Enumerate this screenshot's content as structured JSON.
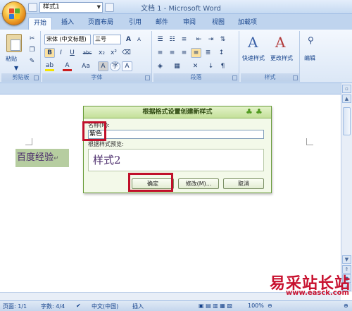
{
  "titlebar": {
    "window_title": "文档 1 - Microsoft Word",
    "style_combo_value": "样式1"
  },
  "tabs": [
    "开始",
    "插入",
    "页面布局",
    "引用",
    "邮件",
    "审阅",
    "视图",
    "加载项"
  ],
  "ribbon": {
    "clipboard": {
      "paste_label": "粘贴",
      "group_label": "剪贴板"
    },
    "font": {
      "font_name": "宋体 (中文标题)",
      "font_size": "三号",
      "bold": "B",
      "italic": "I",
      "underline": "U",
      "strike": "abc",
      "subscript": "x₂",
      "superscript": "x²",
      "change_case": "Aa",
      "char_shading": "A",
      "enclose": "字",
      "grow": "A",
      "shrink": "A",
      "group_label": "字体"
    },
    "paragraph": {
      "group_label": "段落"
    },
    "styles": {
      "quick_styles_label": "快速样式",
      "change_styles_label": "更改样式",
      "group_label": "样式"
    },
    "editing": {
      "label": "编辑"
    }
  },
  "document": {
    "heading_text": "百度经验",
    "para_mark": "↵"
  },
  "dialog": {
    "title": "根据格式设置创建新样式",
    "name_label": "名称(N):",
    "name_value": "紫色",
    "preview_label": "根据样式预览:",
    "preview_text": "样式2",
    "ok_label": "确定",
    "modify_label": "修改(M)...",
    "cancel_label": "取消"
  },
  "statusbar": {
    "page": "页面: 1/1",
    "words": "字数: 4/4",
    "language": "中文(中国)",
    "insert_mode": "插入",
    "zoom": "100%"
  },
  "watermark": {
    "text": "易采站长站",
    "url": "www.easck.com"
  },
  "colors": {
    "highlight": "#c0102a",
    "dialog_border": "#6a9d3a",
    "heading_bg": "#b6cda0"
  }
}
